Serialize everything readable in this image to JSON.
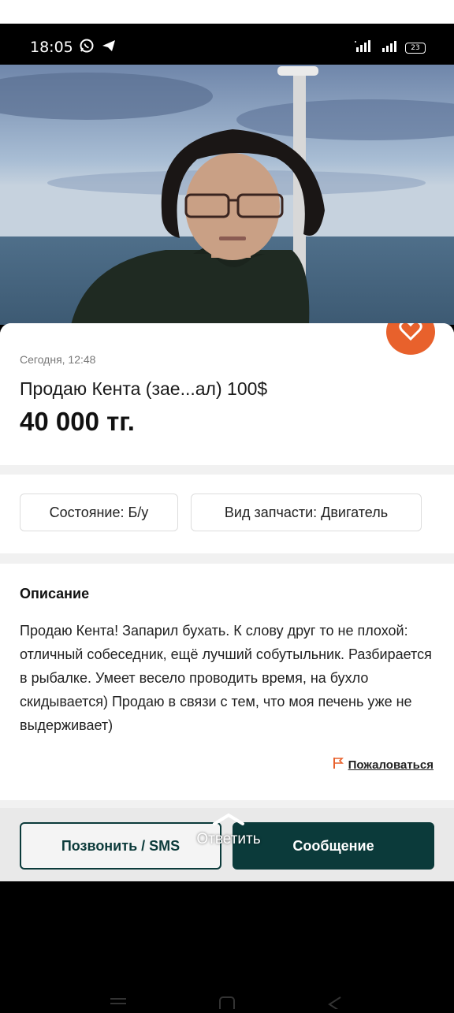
{
  "status_bar": {
    "time": "18:05",
    "battery": "23",
    "left_icons": [
      "whatsapp-icon",
      "telegram-icon"
    ],
    "right_icons": [
      "signal-h-icon",
      "signal-icon",
      "battery-icon"
    ]
  },
  "listing": {
    "date": "Сегодня, 12:48",
    "title": "Продаю Кента (зае...ал) 100$",
    "price": "40 000 тг.",
    "chips": [
      "Состояние: Б/у",
      "Вид запчасти: Двигатель"
    ],
    "description_title": "Описание",
    "description": "Продаю Кента! Запарил бухать. К слову друг то не плохой: отличный собеседник, ещё лучший собутыльник. Разбирается в рыбалке. Умеет весело проводить время, на бухло скидывается) Продаю в связи с тем, что моя печень уже не выдерживает)",
    "report_label": "Пожаловаться"
  },
  "actions": {
    "call_label": "Позвонить / SMS",
    "message_label": "Сообщение"
  },
  "overlay": {
    "reply_label": "Ответить"
  },
  "colors": {
    "accent": "#e8612c",
    "primary_dark": "#0b3a3a"
  }
}
